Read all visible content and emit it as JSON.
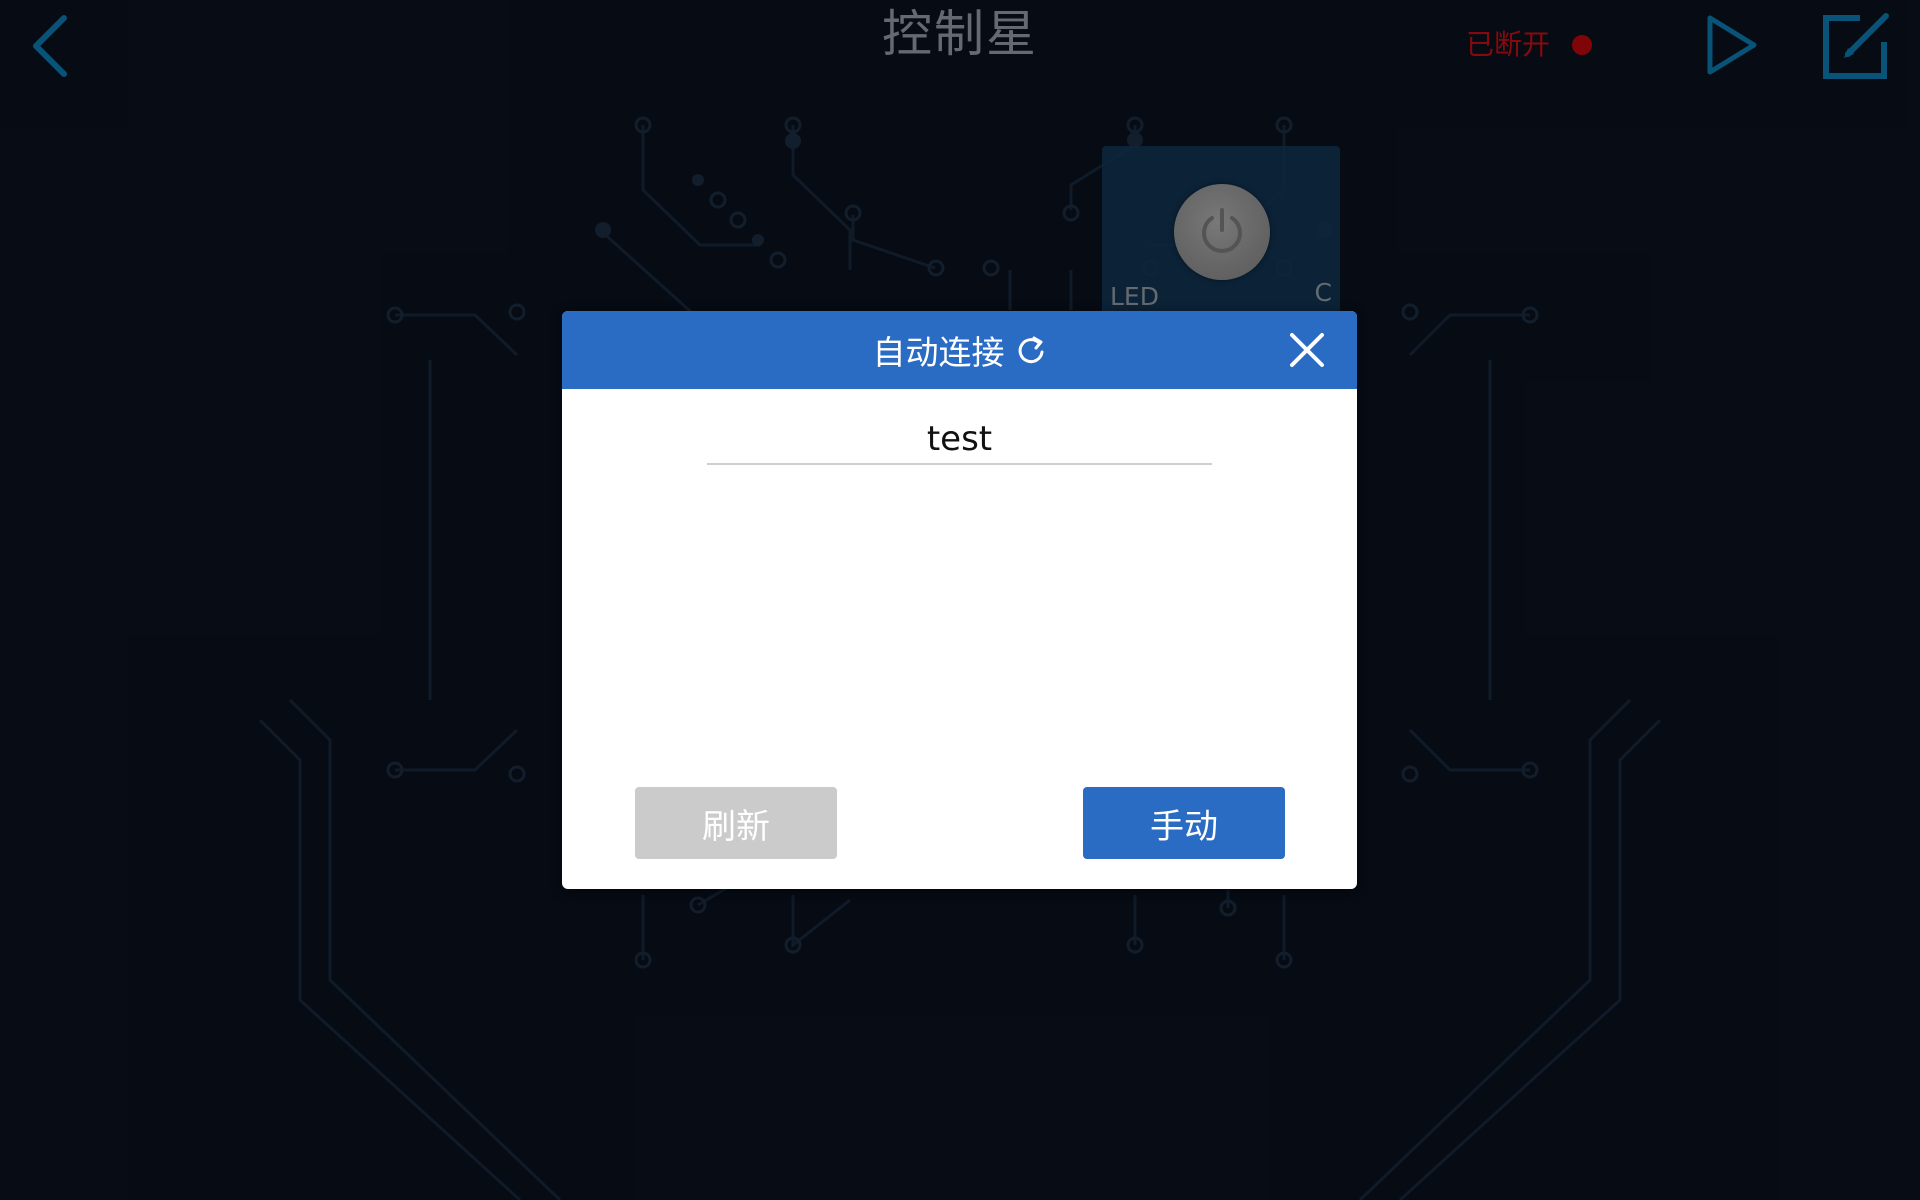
{
  "header": {
    "title": "控制星",
    "status_text": "已断开",
    "status_color": "#cc1016",
    "accent_color": "#0e7fb8",
    "icons": [
      "back-arrow-icon",
      "play-icon",
      "edit-icon"
    ]
  },
  "widget": {
    "label": "LED",
    "corner_text": "C",
    "icon": "power-icon"
  },
  "dialog": {
    "title": "自动连接",
    "title_icon": "refresh-icon",
    "close_icon": "close-icon",
    "header_color": "#2a6bc4",
    "device_name": "test",
    "refresh_button": "刷新",
    "manual_button": "手动"
  }
}
